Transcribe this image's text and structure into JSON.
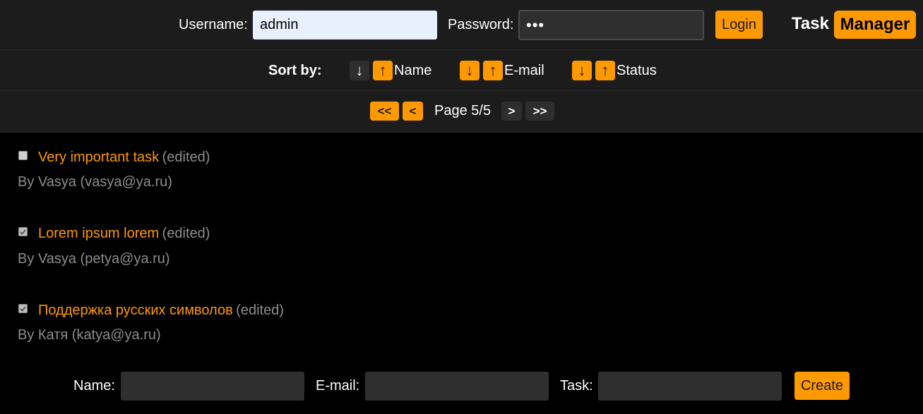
{
  "login": {
    "username_label": "Username:",
    "username_value": "admin",
    "password_label": "Password:",
    "password_value": "•••",
    "login_label": "Login"
  },
  "logo": {
    "part1": "Task",
    "part2": "Manager"
  },
  "sort": {
    "label": "Sort by:",
    "fields": [
      {
        "label": "Name",
        "desc": "↓",
        "asc": "↑",
        "active": "desc"
      },
      {
        "label": "E-mail",
        "desc": "↓",
        "asc": "↑",
        "active": "none"
      },
      {
        "label": "Status",
        "desc": "↓",
        "asc": "↑",
        "active": "none"
      }
    ]
  },
  "pager": {
    "first": "<<",
    "prev": "<",
    "text": "Page 5/5",
    "next": ">",
    "last": ">>"
  },
  "tasks": [
    {
      "title": "Very important task",
      "edited": "(edited)",
      "author": "By Vasya (vasya@ya.ru)",
      "done": false
    },
    {
      "title": "Lorem ipsum lorem",
      "edited": "(edited)",
      "author": "By Vasya (petya@ya.ru)",
      "done": true
    },
    {
      "title": "Поддержка русских символов",
      "edited": "(edited)",
      "author": "By Катя (katya@ya.ru)",
      "done": true
    }
  ],
  "form": {
    "name_label": "Name:",
    "email_label": "E-mail:",
    "task_label": "Task:",
    "create_label": "Create"
  },
  "colors": {
    "accent": "#ff9900",
    "bar_bg": "#1c1c1c",
    "page_bg": "#000000",
    "muted_text": "#8d8d8d",
    "dark_button": "#2e2e2e"
  }
}
